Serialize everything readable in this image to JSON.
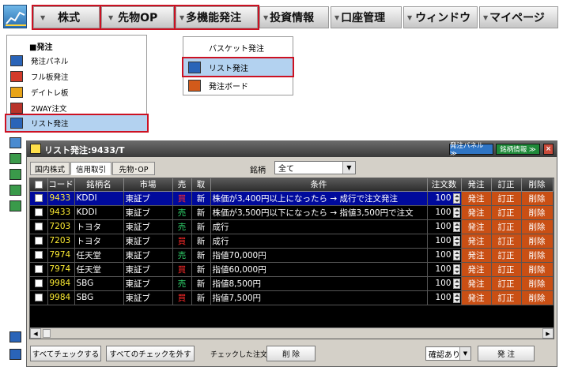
{
  "menubar": {
    "items": [
      {
        "label": "株式",
        "highlight": true
      },
      {
        "label": "先物OP",
        "highlight": true
      },
      {
        "label": "多機能発注",
        "highlight": true
      },
      {
        "label": "投資情報",
        "highlight": false
      },
      {
        "label": "口座管理",
        "highlight": false
      },
      {
        "label": "ウィンドウ",
        "highlight": false
      },
      {
        "label": "マイページ",
        "highlight": false
      }
    ]
  },
  "left_menu": {
    "header": "■発注",
    "items": [
      {
        "label": "発注パネル",
        "icon": "arrow-right-icon"
      },
      {
        "label": "フル板発注",
        "icon": "board-order-icon"
      },
      {
        "label": "デイトレ板",
        "icon": "double-arrow-icon"
      },
      {
        "label": "2WAY注文",
        "icon": "two-way-icon"
      },
      {
        "label": "リスト発注",
        "icon": "list-order-icon",
        "selected": true
      }
    ]
  },
  "sub_menu": {
    "items": [
      {
        "label": "バスケット発注"
      },
      {
        "label": "リスト発注",
        "selected": true
      },
      {
        "label": "発注ボード"
      }
    ]
  },
  "window": {
    "title": "リスト発注:9433/T",
    "panel_button": "発注パネル ≫",
    "info_button": "銘柄情報 ≫",
    "close_glyph": "×",
    "tabs": [
      {
        "label": "国内株式",
        "active": false
      },
      {
        "label": "信用取引",
        "active": true
      },
      {
        "label": "先物･OP",
        "active": false
      }
    ],
    "filter_label": "銘柄",
    "filter_value": "全て",
    "columns": [
      "コード",
      "銘柄名",
      "市場",
      "売",
      "取",
      "条件",
      "注文数",
      "発注",
      "訂正",
      "削除"
    ],
    "rows": [
      {
        "code": "9433",
        "name": "KDDI",
        "market": "東証ブ",
        "side": "買",
        "type": "新",
        "condition": "株価が3,400円以上になったら → 成行で注文発注",
        "qty": "100",
        "order": "発注",
        "modify": "訂正",
        "delete": "削除"
      },
      {
        "code": "9433",
        "name": "KDDI",
        "market": "東証ブ",
        "side": "売",
        "type": "新",
        "condition": "株価が3,500円以下になったら → 指値3,500円で注文",
        "qty": "100",
        "order": "発注",
        "modify": "訂正",
        "delete": "削除"
      },
      {
        "code": "7203",
        "name": "トヨタ",
        "market": "東証ブ",
        "side": "売",
        "type": "新",
        "condition": "成行",
        "qty": "100",
        "order": "発注",
        "modify": "訂正",
        "delete": "削除"
      },
      {
        "code": "7203",
        "name": "トヨタ",
        "market": "東証ブ",
        "side": "買",
        "type": "新",
        "condition": "成行",
        "qty": "100",
        "order": "発注",
        "modify": "訂正",
        "delete": "削除"
      },
      {
        "code": "7974",
        "name": "任天堂",
        "market": "東証ブ",
        "side": "売",
        "type": "新",
        "condition": "指値70,000円",
        "qty": "100",
        "order": "発注",
        "modify": "訂正",
        "delete": "削除"
      },
      {
        "code": "7974",
        "name": "任天堂",
        "market": "東証ブ",
        "side": "買",
        "type": "新",
        "condition": "指値60,000円",
        "qty": "100",
        "order": "発注",
        "modify": "訂正",
        "delete": "削除"
      },
      {
        "code": "9984",
        "name": "SBG",
        "market": "東証ブ",
        "side": "売",
        "type": "新",
        "condition": "指値8,500円",
        "qty": "100",
        "order": "発注",
        "modify": "訂正",
        "delete": "削除"
      },
      {
        "code": "9984",
        "name": "SBG",
        "market": "東証ブ",
        "side": "買",
        "type": "新",
        "condition": "指値7,500円",
        "qty": "100",
        "order": "発注",
        "modify": "訂正",
        "delete": "削除"
      }
    ],
    "bottom": {
      "check_all": "すべてチェックする",
      "uncheck_all": "すべてのチェックを外す",
      "checked_label": "チェックした注文を",
      "delete_button": "削 除",
      "confirm_value": "確認あり",
      "submit_button": "発 注"
    }
  },
  "colors": {
    "highlight_border": "#cc1122",
    "selection_bg": "#b3d2f0",
    "row_selected": "#000a9c",
    "code_yellow": "#ffee33",
    "sell_red": "#ff2a2a",
    "buy_green": "#2fd06a",
    "action_orange": "#c94f14"
  }
}
